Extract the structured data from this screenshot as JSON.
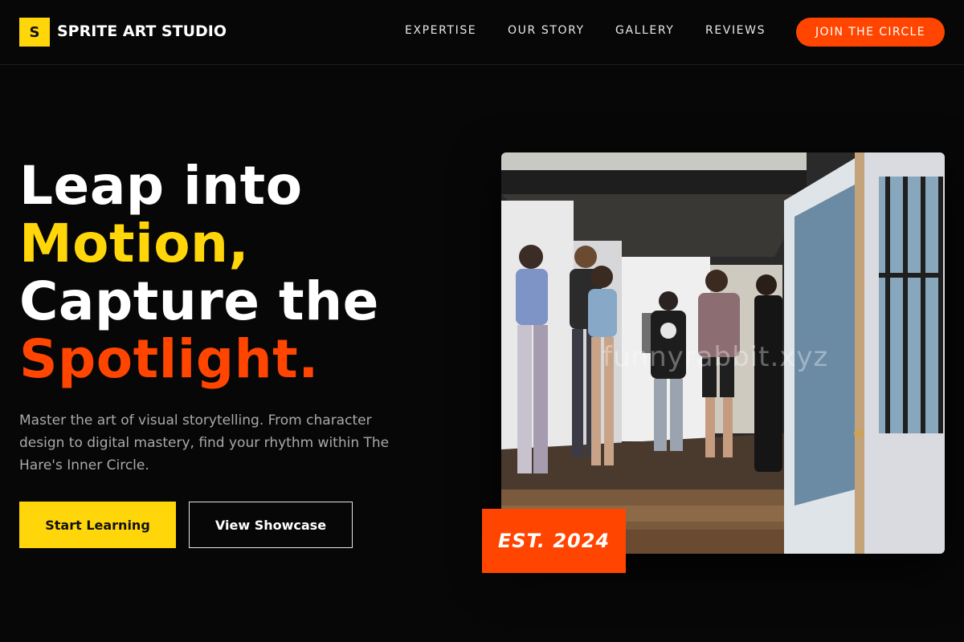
{
  "brand": {
    "logo_letter": "S",
    "name": "SPRITE ART STUDIO",
    "accent_yellow": "#ffd60a",
    "accent_orange": "#ff4500",
    "background": "#070707"
  },
  "nav": {
    "links": [
      "EXPERTISE",
      "OUR STORY",
      "GALLERY",
      "REVIEWS"
    ],
    "cta": "JOIN THE CIRCLE"
  },
  "hero": {
    "headline": [
      "Leap into",
      "Motion,",
      "Capture the",
      "Spotlight."
    ],
    "description": "Master the art of visual storytelling. From character design to digital mastery, find your rhythm within The Hare's Inner Circle.",
    "primary_button": "Start Learning",
    "secondary_button": "View Showcase",
    "badge": "EST. 2024",
    "photo_watermark": "funnyrabbit.xyz"
  }
}
